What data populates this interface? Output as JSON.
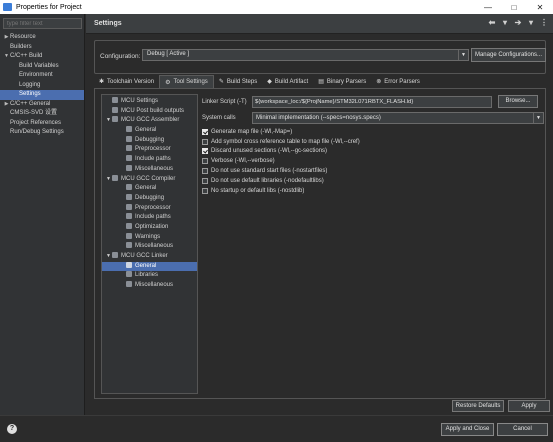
{
  "window": {
    "title": "Properties for Project",
    "minimize_icon": "minimize-icon",
    "maximize_icon": "maximize-icon",
    "close_icon": "close-icon"
  },
  "left_tree": {
    "filter_placeholder": "type filter text",
    "items": [
      {
        "label": "Resource",
        "indent": 0,
        "arrow": "▶",
        "selected": false
      },
      {
        "label": "Builders",
        "indent": 0,
        "arrow": "",
        "selected": false
      },
      {
        "label": "C/C++ Build",
        "indent": 0,
        "arrow": "▼",
        "selected": false
      },
      {
        "label": "Build Variables",
        "indent": 1,
        "arrow": "",
        "selected": false
      },
      {
        "label": "Environment",
        "indent": 1,
        "arrow": "",
        "selected": false
      },
      {
        "label": "Logging",
        "indent": 1,
        "arrow": "",
        "selected": false
      },
      {
        "label": "Settings",
        "indent": 1,
        "arrow": "",
        "selected": true
      },
      {
        "label": "C/C++ General",
        "indent": 0,
        "arrow": "▶",
        "selected": false
      },
      {
        "label": "CMSIS-SVD 设置",
        "indent": 0,
        "arrow": "",
        "selected": false
      },
      {
        "label": "Project References",
        "indent": 0,
        "arrow": "",
        "selected": false
      },
      {
        "label": "Run/Debug Settings",
        "indent": 0,
        "arrow": "",
        "selected": false
      }
    ]
  },
  "settings": {
    "title": "Settings",
    "configuration_label": "Configuration:",
    "configuration_value": "Debug  [ Active ]",
    "manage_button": "Manage Configurations..."
  },
  "tabs": [
    {
      "label": "Toolchain Version",
      "icon": "✱",
      "active": false
    },
    {
      "label": "Tool Settings",
      "icon": "⚙",
      "active": true
    },
    {
      "label": "Build Steps",
      "icon": "✎",
      "active": false
    },
    {
      "label": "Build Artifact",
      "icon": "◆",
      "active": false
    },
    {
      "label": "Binary Parsers",
      "icon": "▤",
      "active": false
    },
    {
      "label": "Error Parsers",
      "icon": "⊗",
      "active": false
    }
  ],
  "tool_tree": [
    {
      "label": "MCU Settings",
      "indent": 0,
      "arrow": "",
      "selected": false
    },
    {
      "label": "MCU Post build outputs",
      "indent": 0,
      "arrow": "",
      "selected": false
    },
    {
      "label": "MCU GCC Assembler",
      "indent": 0,
      "arrow": "▼",
      "selected": false
    },
    {
      "label": "General",
      "indent": 1,
      "arrow": "",
      "selected": false
    },
    {
      "label": "Debugging",
      "indent": 1,
      "arrow": "",
      "selected": false
    },
    {
      "label": "Preprocessor",
      "indent": 1,
      "arrow": "",
      "selected": false
    },
    {
      "label": "Include paths",
      "indent": 1,
      "arrow": "",
      "selected": false
    },
    {
      "label": "Miscellaneous",
      "indent": 1,
      "arrow": "",
      "selected": false
    },
    {
      "label": "MCU GCC Compiler",
      "indent": 0,
      "arrow": "▼",
      "selected": false
    },
    {
      "label": "General",
      "indent": 1,
      "arrow": "",
      "selected": false
    },
    {
      "label": "Debugging",
      "indent": 1,
      "arrow": "",
      "selected": false
    },
    {
      "label": "Preprocessor",
      "indent": 1,
      "arrow": "",
      "selected": false
    },
    {
      "label": "Include paths",
      "indent": 1,
      "arrow": "",
      "selected": false
    },
    {
      "label": "Optimization",
      "indent": 1,
      "arrow": "",
      "selected": false
    },
    {
      "label": "Warnings",
      "indent": 1,
      "arrow": "",
      "selected": false
    },
    {
      "label": "Miscellaneous",
      "indent": 1,
      "arrow": "",
      "selected": false
    },
    {
      "label": "MCU GCC Linker",
      "indent": 0,
      "arrow": "▼",
      "selected": false
    },
    {
      "label": "General",
      "indent": 1,
      "arrow": "",
      "selected": true
    },
    {
      "label": "Libraries",
      "indent": 1,
      "arrow": "",
      "selected": false
    },
    {
      "label": "Miscellaneous",
      "indent": 1,
      "arrow": "",
      "selected": false
    }
  ],
  "linker": {
    "script_label": "Linker Script (-T)",
    "script_value": "${workspace_loc:/${ProjName}/STM32L071RBTX_FLASH.ld}",
    "browse_button": "Browse...",
    "system_calls_label": "System calls",
    "system_calls_value": "Minimal implementation (--specs=nosys.specs)",
    "options": [
      {
        "label": "Generate map file (-Wl,-Map=)",
        "checked": true
      },
      {
        "label": "Add symbol cross reference table to map file (-Wl,--cref)",
        "checked": false
      },
      {
        "label": "Discard unused sections (-Wl,--gc-sections)",
        "checked": true
      },
      {
        "label": "Verbose (-Wl,--verbose)",
        "checked": false
      },
      {
        "label": "Do not use standard start files (-nostartfiles)",
        "checked": false
      },
      {
        "label": "Do not use default libraries (-nodefaultlibs)",
        "checked": false
      },
      {
        "label": "No startup or default libs (-nostdlib)",
        "checked": false
      }
    ]
  },
  "buttons": {
    "restore_defaults": "Restore Defaults",
    "apply": "Apply",
    "apply_and_close": "Apply and Close",
    "cancel": "Cancel"
  },
  "colors": {
    "selection": "#4b6eaf",
    "background": "#2b2b2b"
  }
}
